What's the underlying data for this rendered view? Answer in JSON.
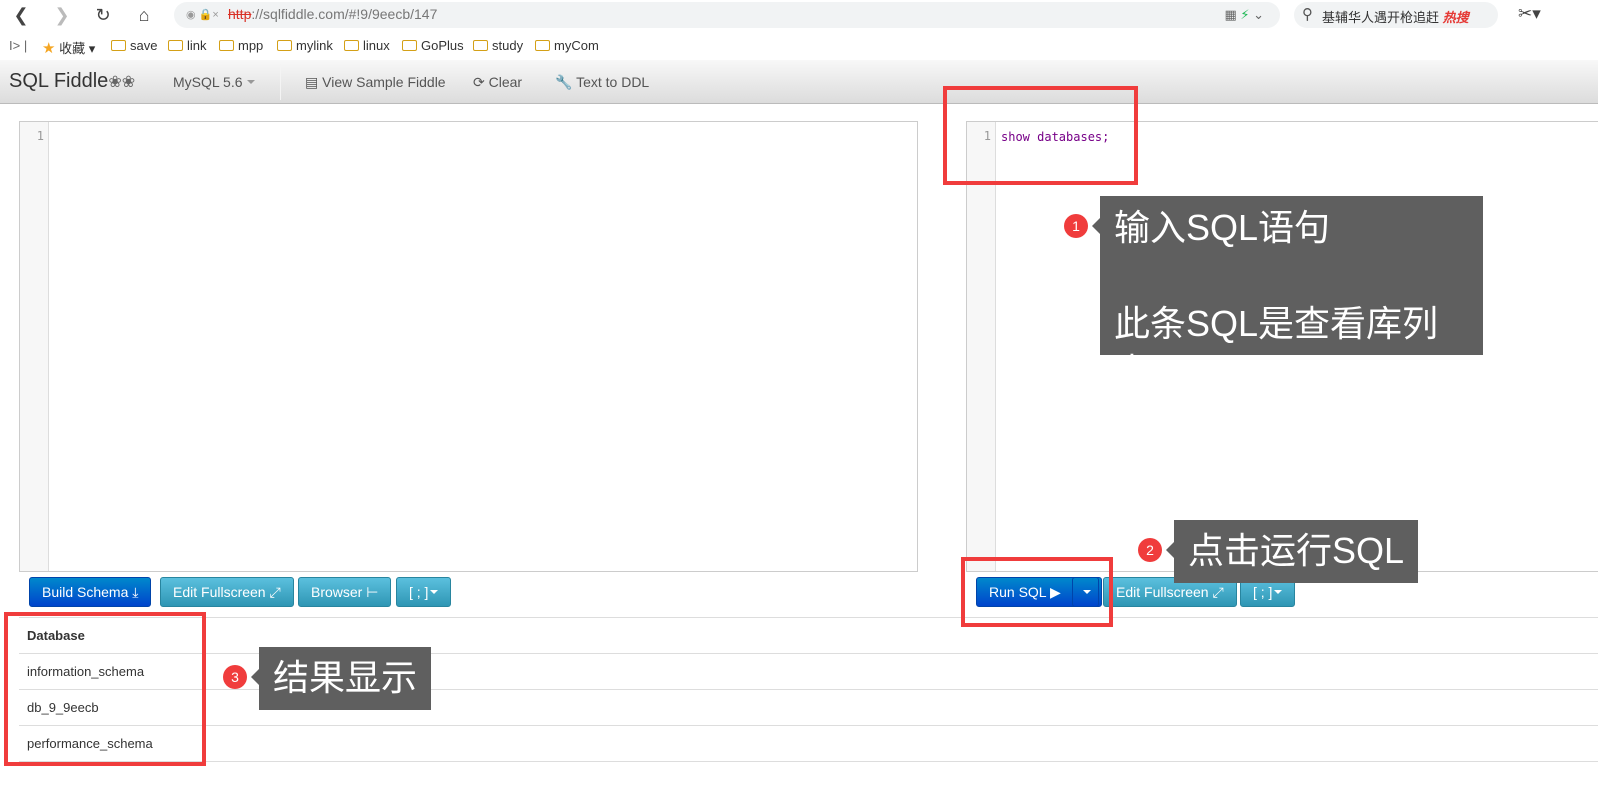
{
  "browser": {
    "url_scheme": "http",
    "url_rest": "://sqlfiddle.com/#!9/9eecb/147",
    "search_text": "基辅华人遇开枪追赶",
    "search_hot": "热搜"
  },
  "bookmarks": {
    "favorites_label": "收藏",
    "folders": [
      "save",
      "link",
      "mpp",
      "mylink",
      "linux",
      "GoPlus",
      "study",
      "myCom"
    ]
  },
  "navbar": {
    "brand": "SQL Fiddle",
    "db_version": "MySQL 5.6",
    "view_sample": "View Sample Fiddle",
    "clear": "Clear",
    "text_to_ddl": "Text to DDL"
  },
  "schema_panel": {
    "line_number": "1",
    "code": "",
    "build_schema": "Build Schema",
    "edit_fullscreen": "Edit Fullscreen",
    "browser": "Browser",
    "delimiter": "[ ; ]"
  },
  "sql_panel": {
    "line_number": "1",
    "code": "show databases;",
    "run_sql": "Run SQL",
    "edit_fullscreen": "Edit Fullscreen",
    "delimiter": "[ ; ]"
  },
  "results": {
    "column": "Database",
    "rows": [
      "information_schema",
      "db_9_9eecb",
      "performance_schema"
    ]
  },
  "annotations": {
    "step1_number": "1",
    "step1_line1": "输入SQL语句",
    "step1_line2": "此条SQL是查看库列表",
    "step2_number": "2",
    "step2_text": "点击运行SQL",
    "step3_number": "3",
    "step3_text": "结果显示",
    "highlight_color": "#f03c3c",
    "tip_background": "#5f5f5f"
  }
}
